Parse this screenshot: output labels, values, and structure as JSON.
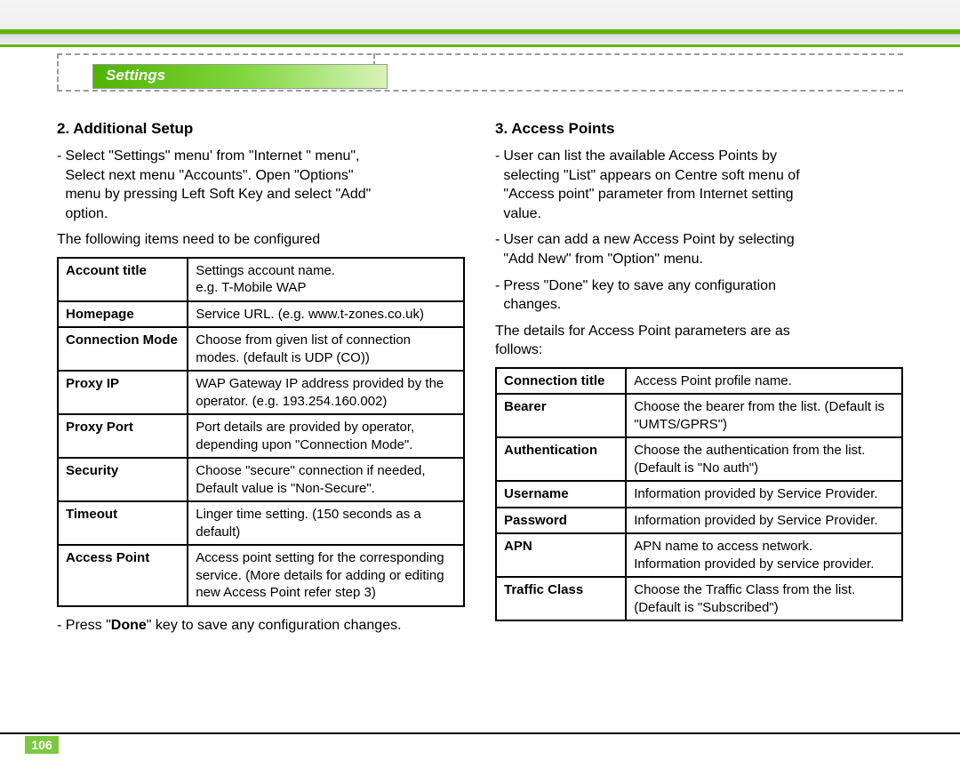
{
  "header": {
    "tab_label": "Settings"
  },
  "page": {
    "number": "106"
  },
  "left": {
    "heading": "2. Additional Setup",
    "bullet1_lines": [
      "Select \"Settings\" menu' from \"Internet \" menu\",",
      "Select next menu \"Accounts\".  Open \"Options\"",
      "menu by pressing Left Soft Key and select \"Add\"",
      "option."
    ],
    "config_intro": "The following items need to be configured",
    "table": [
      {
        "k": "Account title",
        "v": "Settings account name.\ne.g. T-Mobile WAP"
      },
      {
        "k": "Homepage",
        "v": "Service URL. (e.g. www.t-zones.co.uk)"
      },
      {
        "k": "Connection Mode",
        "v": "Choose from given list of connection modes. (default is UDP (CO))"
      },
      {
        "k": "Proxy IP",
        "v": "WAP Gateway IP address provided by the operator. (e.g. 193.254.160.002)"
      },
      {
        "k": "Proxy Port",
        "v": "Port details are provided by operator, depending upon \"Connection Mode\"."
      },
      {
        "k": "Security",
        "v": "Choose \"secure\" connection if needed, Default value is \"Non-Secure\"."
      },
      {
        "k": "Timeout",
        "v": "Linger time setting. (150 seconds as a default)"
      },
      {
        "k": "Access Point",
        "v": "Access point setting for the corresponding service. (More details for adding or editing new Access Point refer step 3)"
      }
    ],
    "after_table_prefix": "- Press \"",
    "after_table_bold": "Done",
    "after_table_suffix": "\" key to save any configuration changes."
  },
  "right": {
    "heading": "3. Access Points",
    "bullet1_lines": [
      "User can list the available Access Points by",
      "selecting \"List\" appears on Centre soft menu of",
      "\"Access point\" parameter from Internet setting",
      "value."
    ],
    "bullet2_lines": [
      "User can add a new Access Point by selecting",
      "\"Add New\" from \"Option\" menu."
    ],
    "bullet3_lines": [
      "Press \"Done\" key to save any configuration",
      "changes."
    ],
    "details_intro_lines": [
      "The details for Access Point parameters are as",
      "follows:"
    ],
    "table": [
      {
        "k": "Connection title",
        "v": "Access Point profile name."
      },
      {
        "k": "Bearer",
        "v": "Choose the bearer from the list. (Default is \"UMTS/GPRS\")"
      },
      {
        "k": "Authentication",
        "v": "Choose the authentication from the list. (Default is \"No auth\")"
      },
      {
        "k": "Username",
        "v": "Information provided by Service Provider."
      },
      {
        "k": "Password",
        "v": "Information provided by Service Provider."
      },
      {
        "k": "APN",
        "v": "APN name to access network.\nInformation provided by service provider."
      },
      {
        "k": "Traffic Class",
        "v": "Choose the Traffic Class from the list. (Default is \"Subscribed\")"
      }
    ]
  }
}
